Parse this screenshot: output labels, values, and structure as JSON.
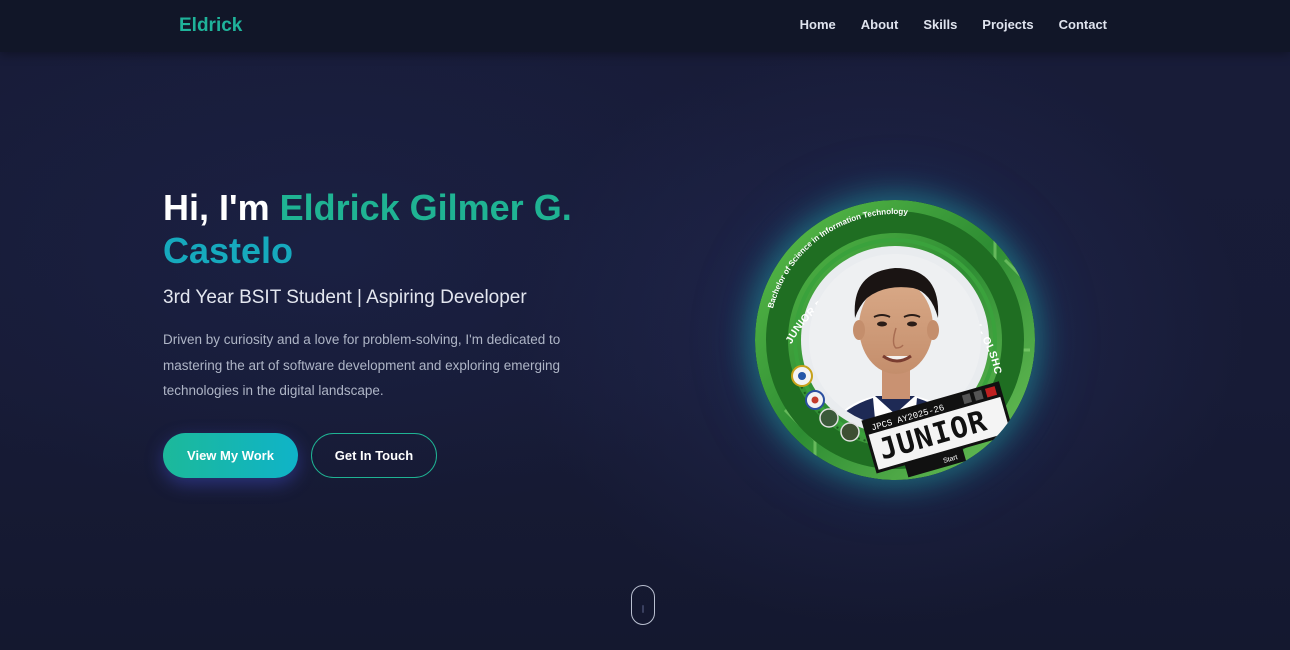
{
  "nav": {
    "brand": "Eldrick",
    "links": [
      "Home",
      "About",
      "Skills",
      "Projects",
      "Contact"
    ]
  },
  "hero": {
    "greeting": "Hi, I'm ",
    "name_line1": "Eldrick Gilmer G.",
    "name_line2": "Castelo",
    "subtitle": "3rd Year BSIT Student | Aspiring Developer",
    "description": "Driven by curiosity and a love for problem-solving, I'm dedicated to mastering the art of software development and exploring emerging technologies in the digital landscape.",
    "primary_button": "View My Work",
    "secondary_button": "Get In Touch"
  },
  "profile_badge": {
    "arc_top": "Bachelor of Science in Information Technology",
    "arc_main": "JUNIOR PHILIPPINE COMPUTER SOCIETY - OLSHCO CHAPTER",
    "ticket_small": "JPCS AY2025-26",
    "ticket_big": "JUNIOR",
    "ticket_start": "Start"
  },
  "colors": {
    "accent_green": "#1fb393",
    "accent_cyan": "#16a9bd",
    "background": "#161a33",
    "nav_background": "#111628",
    "badge_green": "#2f8f2f"
  },
  "icons": {
    "scroll": "mouse-scroll-icon"
  }
}
